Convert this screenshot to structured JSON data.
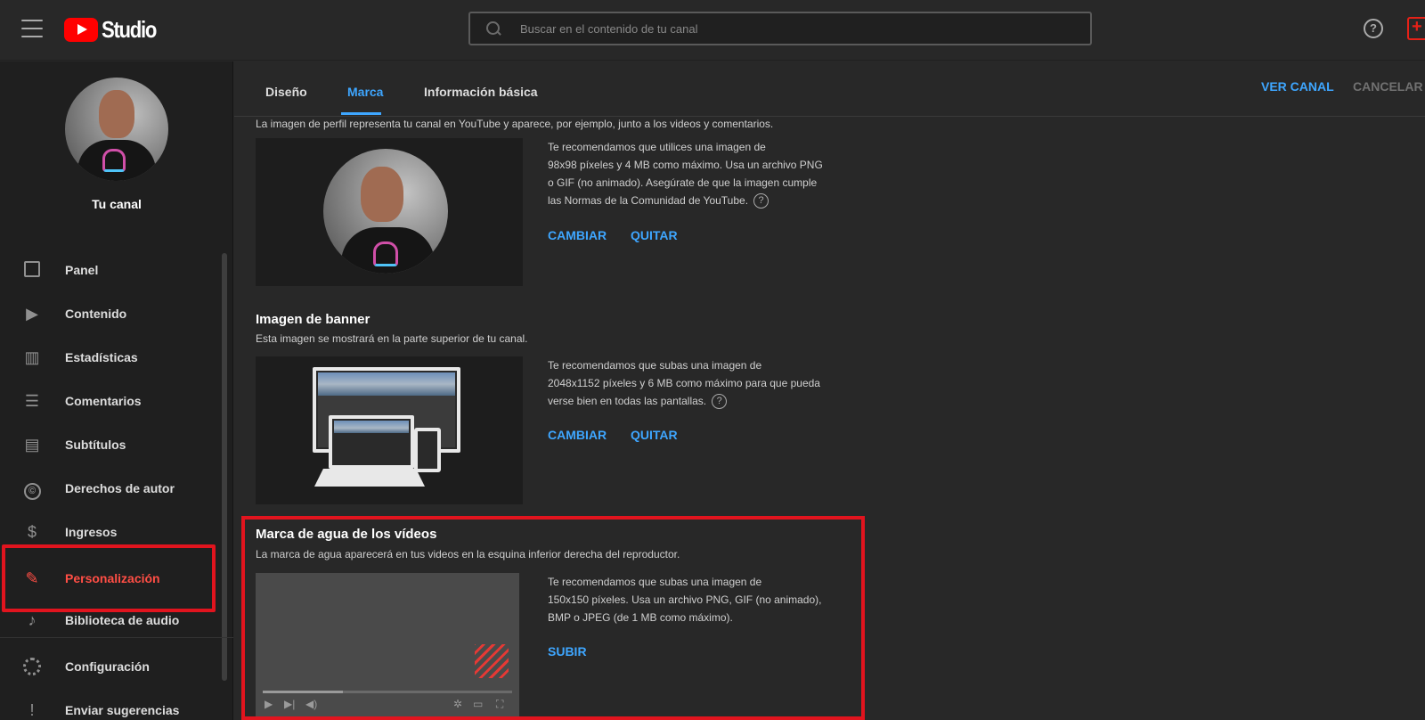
{
  "header": {
    "logo_text": "Studio",
    "search_placeholder": "Buscar en el contenido de tu canal"
  },
  "sidebar": {
    "channel_name": "Tu canal",
    "items": [
      {
        "label": "Panel",
        "icon": "dashboard-icon"
      },
      {
        "label": "Contenido",
        "icon": "content-icon"
      },
      {
        "label": "Estadísticas",
        "icon": "analytics-icon"
      },
      {
        "label": "Comentarios",
        "icon": "comments-icon"
      },
      {
        "label": "Subtítulos",
        "icon": "subtitles-icon"
      },
      {
        "label": "Derechos de autor",
        "icon": "copyright-icon"
      },
      {
        "label": "Ingresos",
        "icon": "dollar-icon"
      },
      {
        "label": "Personalización",
        "icon": "magic-wand-icon",
        "active": true
      },
      {
        "label": "Biblioteca de audio",
        "icon": "audio-library-icon"
      },
      {
        "label": "Configuración",
        "icon": "gear-icon"
      },
      {
        "label": "Enviar sugerencias",
        "icon": "feedback-icon"
      }
    ]
  },
  "tabs": {
    "items": [
      "Diseño",
      "Marca",
      "Información básica"
    ],
    "active": "Marca",
    "ver_canal": "VER CANAL",
    "cancelar": "CANCELAR"
  },
  "profile": {
    "description": "La imagen de perfil representa tu canal en YouTube y aparece, por ejemplo, junto a los videos y comentarios.",
    "rec_1": "Te recomendamos que utilices una imagen de",
    "rec_2": "98x98 píxeles y 4 MB como máximo. Usa un archivo PNG",
    "rec_3": "o GIF (no animado). Asegúrate de que la imagen cumple",
    "rec_4": "las Normas de la Comunidad de YouTube.",
    "change": "CAMBIAR",
    "remove": "QUITAR"
  },
  "banner": {
    "title": "Imagen de banner",
    "description": "Esta imagen se mostrará en la parte superior de tu canal.",
    "rec_1": "Te recomendamos que subas una imagen de",
    "rec_2": "2048x1152 píxeles y 6 MB como máximo para que pueda",
    "rec_3": "verse bien en todas las pantallas.",
    "change": "CAMBIAR",
    "remove": "QUITAR"
  },
  "watermark": {
    "title": "Marca de agua de los vídeos",
    "description": "La marca de agua aparecerá en tus videos en la esquina inferior derecha del reproductor.",
    "rec_1": "Te recomendamos que subas una imagen de",
    "rec_2": "150x150 píxeles. Usa un archivo PNG, GIF (no animado),",
    "rec_3": "BMP o JPEG (de 1 MB como máximo).",
    "upload": "SUBIR"
  },
  "colors": {
    "accent": "#3ea6ff",
    "active_red": "#ff4e45",
    "highlight_red": "#e1141e",
    "background": "#282828"
  }
}
